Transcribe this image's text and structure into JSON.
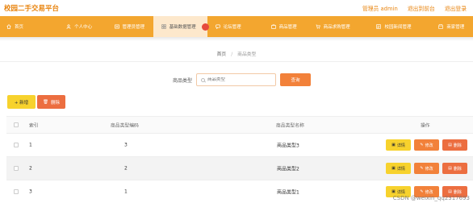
{
  "app": {
    "title": "校园二手交易平台"
  },
  "top_links": [
    "管理员 admin",
    "退出到前台",
    "退出登录"
  ],
  "nav": [
    {
      "label": "首页",
      "icon": "home-icon"
    },
    {
      "label": "个人中心",
      "icon": "user-icon"
    },
    {
      "label": "管理员管理",
      "icon": "admin-icon"
    },
    {
      "label": "基础数据管理",
      "icon": "grid-icon",
      "active": true
    },
    {
      "label": "论坛管理",
      "icon": "forum-icon"
    },
    {
      "label": "商品管理",
      "icon": "goods-icon"
    },
    {
      "label": "商品求购管理",
      "icon": "cart-icon"
    },
    {
      "label": "校园新闻管理",
      "icon": "news-icon"
    },
    {
      "label": "商家管理",
      "icon": "shop-icon"
    }
  ],
  "breadcrumb": {
    "home": "首页",
    "separator": "/",
    "current": "商品类型"
  },
  "search": {
    "label": "商品类型",
    "placeholder": "商品类型",
    "button": "查询"
  },
  "toolbar": {
    "add": "+ 新增",
    "delete": "删除"
  },
  "table": {
    "headers": [
      "索引",
      "商品类型编码",
      "商品类型名称",
      "操作"
    ],
    "rows": [
      {
        "index": "1",
        "code": "3",
        "name": "商品类型3"
      },
      {
        "index": "2",
        "code": "2",
        "name": "商品类型2"
      },
      {
        "index": "3",
        "code": "1",
        "name": "商品类型1"
      }
    ],
    "actions": {
      "detail": "详情",
      "edit": "修改",
      "remove": "删除"
    }
  },
  "watermark": "CSDN @weixin_qq2317693",
  "colors": {
    "accent": "#f3a62f",
    "brand_text": "#e8840f",
    "yellow": "#f7d22d",
    "orange": "#f2813a",
    "red": "#ec6e40"
  }
}
